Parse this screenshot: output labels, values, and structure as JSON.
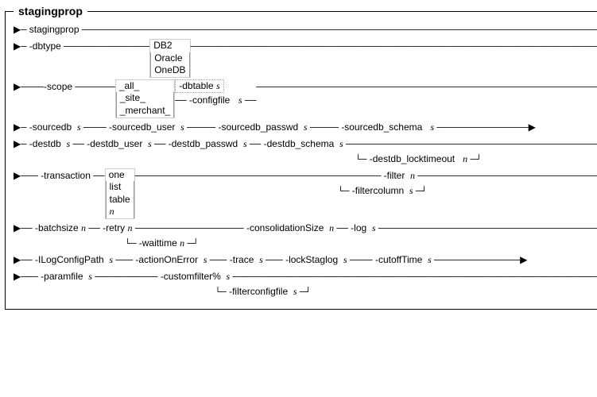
{
  "diagram_title": "stagingprop",
  "commands": {
    "main": "stagingprop",
    "dbtype_flag": "-dbtype",
    "dbtype_options": [
      "DB2",
      "Oracle",
      "OneDB"
    ],
    "scope_flag": "-scope",
    "scope_options": [
      "_all_",
      "_site_",
      "_merchant_"
    ],
    "dbtable": "-dbtable",
    "configfile": "-configfile",
    "sourcedb": "-sourcedb",
    "sourcedb_user": "-sourcedb_user",
    "sourcedb_passwd": "-sourcedb_passwd",
    "sourcedb_schema": "-sourcedb_schema",
    "destdb": "-destdb",
    "destdb_user": "-destdb_user",
    "destdb_passwd": "-destdb_passwd",
    "destdb_schema": "-destdb_schema",
    "destdb_locktimeout": "-destdb_locktimeout",
    "transaction_flag": "-transaction",
    "transaction_options": [
      "one",
      "list",
      "table",
      "n"
    ],
    "filter": "-filter",
    "filtercolumn": "-filtercolumn",
    "batchsize": "-batchsize",
    "retry": "-retry",
    "waittime": "-waittime",
    "consolidationSize": "-consolidationSize",
    "log": "-log",
    "ilogconfigpath": "-ILogConfigPath",
    "actionOnError": "-actionOnError",
    "trace": "-trace",
    "lockStaglog": "-lockStaglog",
    "cutoffTime": "-cutoffTime",
    "paramfile": "-paramfile",
    "customfilter": "-customfilter%",
    "filterconfigfile": "-filterconfigfile"
  },
  "vars": {
    "s": "s",
    "n": "n"
  },
  "arrows": {
    "right_long": "───────────────────────────────────────────────────────────────────────▶",
    "start": "▶──",
    "mid": "──",
    "cont": "───"
  }
}
